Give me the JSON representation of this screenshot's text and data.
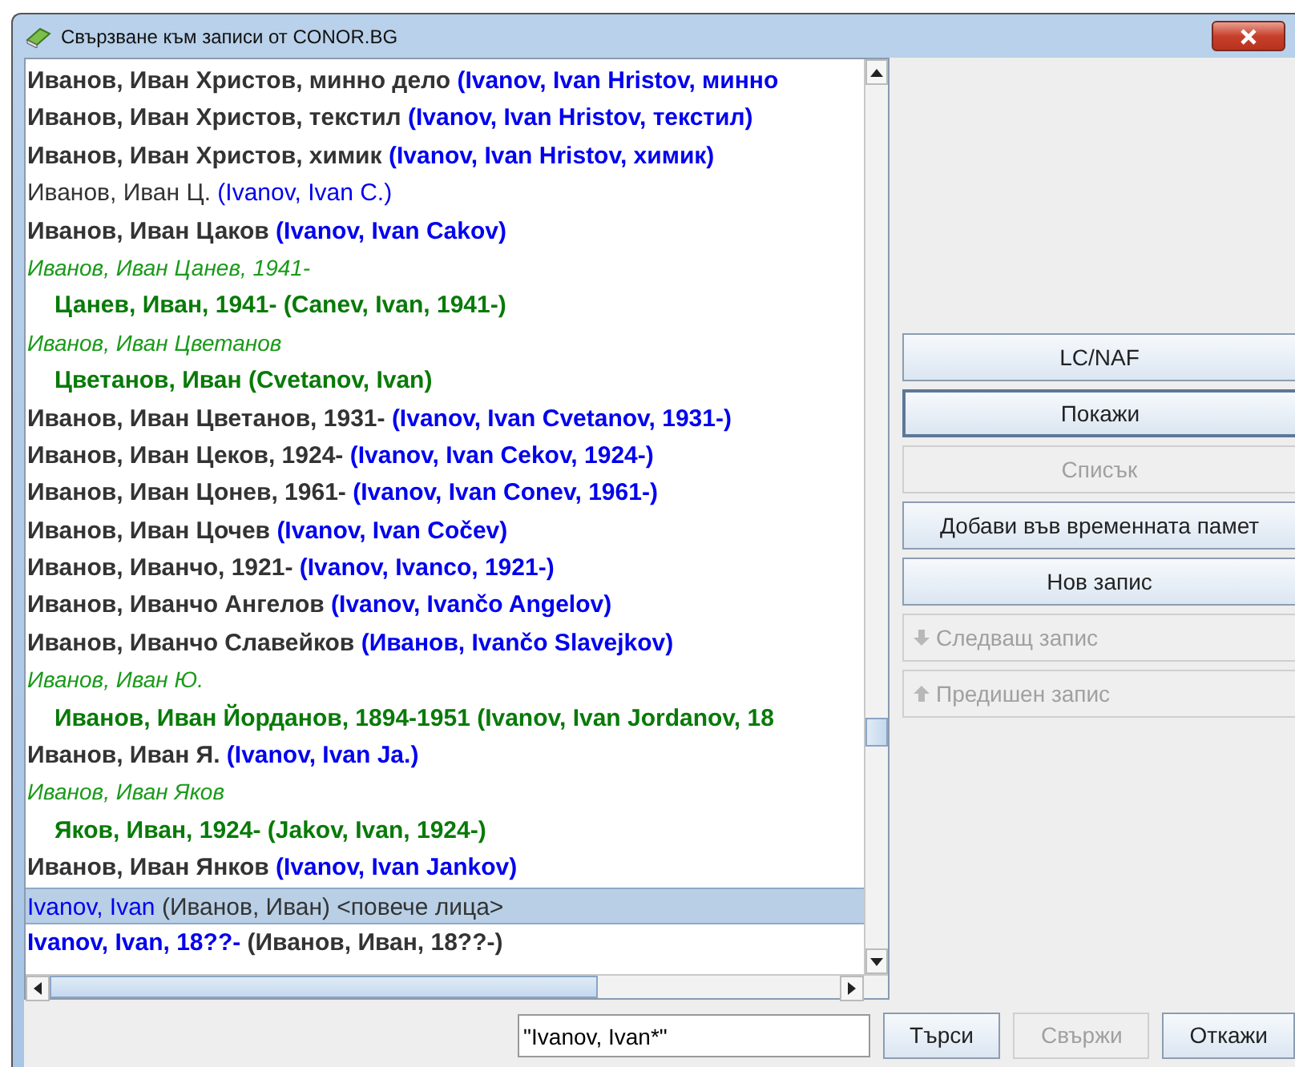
{
  "window": {
    "title": "Свързване към записи от CONOR.BG"
  },
  "results": [
    {
      "kind": "heading",
      "bold": true,
      "selected": false,
      "text": "Иванов, Иван Христов, минно дело",
      "alt": "(Ivanov, Ivan Hristov, минно"
    },
    {
      "kind": "heading",
      "bold": true,
      "selected": false,
      "text": "Иванов, Иван Христов, текстил",
      "alt": "(Ivanov, Ivan Hristov, текстил)"
    },
    {
      "kind": "heading",
      "bold": true,
      "selected": false,
      "text": "Иванов, Иван Христов, химик",
      "alt": "(Ivanov, Ivan Hristov, химик)"
    },
    {
      "kind": "heading",
      "bold": false,
      "selected": false,
      "text": "Иванов, Иван Ц.",
      "alt": "(Ivanov, Ivan C.)"
    },
    {
      "kind": "heading",
      "bold": true,
      "selected": false,
      "text": "Иванов, Иван Цаков",
      "alt": "(Ivanov, Ivan Cakov)"
    },
    {
      "kind": "see",
      "bold": false,
      "selected": false,
      "text": "Иванов, Иван Цанев, 1941-"
    },
    {
      "kind": "ref",
      "bold": true,
      "selected": false,
      "text": "Цанев, Иван, 1941- (Canev, Ivan, 1941-)"
    },
    {
      "kind": "see",
      "bold": false,
      "selected": false,
      "text": "Иванов, Иван Цветанов"
    },
    {
      "kind": "ref",
      "bold": true,
      "selected": false,
      "text": "Цветанов, Иван (Cvetanov, Ivan)"
    },
    {
      "kind": "heading",
      "bold": true,
      "selected": false,
      "text": "Иванов, Иван Цветанов, 1931-",
      "alt": "(Ivanov, Ivan Cvetanov, 1931-)"
    },
    {
      "kind": "heading",
      "bold": true,
      "selected": false,
      "text": "Иванов, Иван Цеков, 1924-",
      "alt": "(Ivanov, Ivan Cekov, 1924-)"
    },
    {
      "kind": "heading",
      "bold": true,
      "selected": false,
      "text": "Иванов, Иван Цонев, 1961-",
      "alt": "(Ivanov, Ivan Conev, 1961-)"
    },
    {
      "kind": "heading",
      "bold": true,
      "selected": false,
      "text": "Иванов, Иван Цочев",
      "alt": "(Ivanov, Ivan Cočev)"
    },
    {
      "kind": "heading",
      "bold": true,
      "selected": false,
      "text": "Иванов, Иванчо, 1921-",
      "alt": "(Ivanov, Ivanco, 1921-)"
    },
    {
      "kind": "heading",
      "bold": true,
      "selected": false,
      "text": "Иванов, Иванчо Ангелов",
      "alt": "(Ivanov, Ivančo Angelov)"
    },
    {
      "kind": "heading",
      "bold": true,
      "selected": false,
      "text": "Иванов, Иванчо Славейков",
      "alt": "(Иванов, Ivančo Slavejkov)"
    },
    {
      "kind": "see",
      "bold": false,
      "selected": false,
      "text": "Иванов, Иван Ю."
    },
    {
      "kind": "ref",
      "bold": true,
      "selected": false,
      "text": "Иванов, Иван Йорданов, 1894-1951 (Ivanov, Ivan Jordanov, 18"
    },
    {
      "kind": "heading",
      "bold": true,
      "selected": false,
      "text": "Иванов, Иван Я.",
      "alt": "(Ivanov, Ivan Ja.)"
    },
    {
      "kind": "see",
      "bold": false,
      "selected": false,
      "text": "Иванов, Иван Яков"
    },
    {
      "kind": "ref",
      "bold": true,
      "selected": false,
      "text": "Яков, Иван, 1924- (Jakov, Ivan, 1924-)"
    },
    {
      "kind": "heading",
      "bold": true,
      "selected": false,
      "text": "Иванов, Иван Янков",
      "alt": "(Ivanov, Ivan Jankov)"
    },
    {
      "kind": "latin",
      "bold": false,
      "selected": true,
      "text": "Ivanov, Ivan",
      "alt": "(Иванов, Иван) <повече лица>"
    },
    {
      "kind": "latin",
      "bold": true,
      "selected": false,
      "text": "Ivanov, Ivan, 18??-",
      "alt": "(Иванов, Иван, 18??-)"
    }
  ],
  "side_buttons": [
    {
      "kind": "text",
      "label": "LC/NAF",
      "disabled": false,
      "focused": false
    },
    {
      "kind": "text",
      "label": "Покажи",
      "disabled": false,
      "focused": true
    },
    {
      "kind": "text",
      "label": "Списък",
      "disabled": true,
      "focused": false
    },
    {
      "kind": "text",
      "label": "Добави във временната памет",
      "disabled": false,
      "focused": false
    },
    {
      "kind": "text",
      "label": "Нов запис",
      "disabled": false,
      "focused": false
    },
    {
      "kind": "next",
      "label": "Следващ запис",
      "disabled": true,
      "focused": false
    },
    {
      "kind": "previous",
      "label": "Предишен запис",
      "disabled": true,
      "focused": false
    }
  ],
  "search": {
    "value": "\"Ivanov, Ivan*\""
  },
  "bottom_buttons": [
    {
      "label": "Търси",
      "disabled": false
    },
    {
      "label": "Свържи",
      "disabled": true
    },
    {
      "label": "Откажи",
      "disabled": false
    }
  ]
}
